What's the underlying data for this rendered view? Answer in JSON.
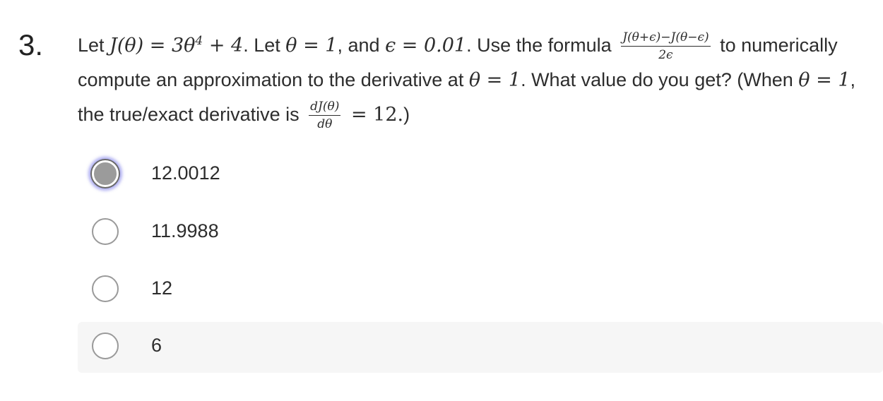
{
  "question": {
    "number": "3.",
    "t1": "Let ",
    "m1": "J(θ) = 3θ",
    "m1_sup": "4",
    "m1b": " + 4",
    "t2": ". Let ",
    "m2": "θ = 1",
    "t3": ", and ",
    "m3": "ϵ = 0.01",
    "t4": ". Use the formula ",
    "frac1_num": "J(θ+ϵ)−J(θ−ϵ)",
    "frac1_den": "2ϵ",
    "t5": " to numerically compute an approximation to the derivative at ",
    "m4": "θ = 1",
    "t6": ". What value do you get? (When ",
    "m5": "θ = 1",
    "t7": ", the true/exact derivative is ",
    "frac2_num": "dJ(θ)",
    "frac2_den": "dθ",
    "m6": " = 12.",
    "t8": ")"
  },
  "options": [
    {
      "label": "12.0012",
      "selected": true
    },
    {
      "label": "11.9988",
      "selected": false
    },
    {
      "label": "12",
      "selected": false
    },
    {
      "label": "6",
      "selected": false
    }
  ]
}
